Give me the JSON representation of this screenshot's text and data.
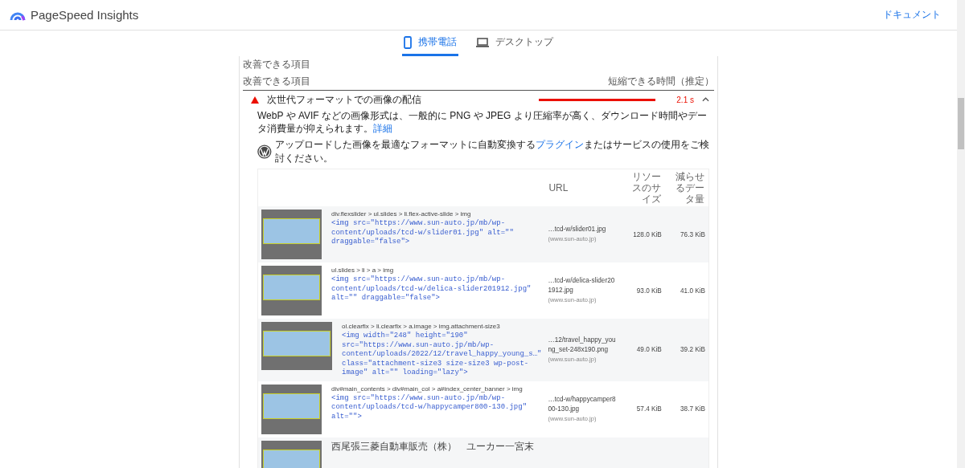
{
  "header": {
    "title": "PageSpeed Insights",
    "docs_link": "ドキュメント"
  },
  "tabs": [
    {
      "label": "携帯電話",
      "selected": true
    },
    {
      "label": "デスクトップ",
      "selected": false
    }
  ],
  "section_title": "改善できる項目",
  "list_header": {
    "left": "改善できる項目",
    "right": "短縮できる時間（推定）"
  },
  "audit": {
    "title": "次世代フォーマットでの画像の配信",
    "level": 1,
    "value": "2.1 s",
    "expanded": true,
    "description": "WebP や AVIF などの画像形式は、一般的に PNG や JPEG より圧縮率が高く、ダウンロード時間やデータ消費量が抑えられます。",
    "description_link": "詳細",
    "tip_before": "アップロードした画像を最適なフォーマットに自動変換する",
    "tip_link": "プラグイン",
    "tip_after": "またはサービスの使用をご検討ください。",
    "table": {
      "columns": [
        "URL",
        "リソースのサイズ",
        "減らせるデータ量"
      ],
      "rows": [
        {
          "kind": "banner",
          "selector": "div.flexslider > ul.slides > li.flex-active-slide > img",
          "snippet": "<img src=\"https://www.sun-auto.jp/mb/wp-content/uploads/tcd-w/slider01.jpg\" alt=\"\" draggable=\"false\">",
          "url": "…tcd-w/slider01.jpg",
          "host": "(www.sun-auto.jp)",
          "size": "128.0 KiB",
          "savings": "76.3 KiB"
        },
        {
          "kind": "banner",
          "selector": "ul.slides > li > a > img",
          "snippet": "<img src=\"https://www.sun-auto.jp/mb/wp-content/uploads/tcd-w/delica-slider201912.jpg\" alt=\"\" draggable=\"false\">",
          "url": "…tcd-w/delica-slider201912.jpg",
          "host": "(www.sun-auto.jp)",
          "size": "93.0 KiB",
          "savings": "41.0 KiB"
        },
        {
          "kind": "wide",
          "selector": "ol.clearfix > li.clearfix > a.image > img.attachment-size3",
          "snippet": "<img width=\"248\" height=\"190\" src=\"https://www.sun-auto.jp/mb/wp-content/uploads/2022/12/travel_happy_young_s…\" class=\"attachment-size3 size-size3 wp-post-image\" alt=\"\" loading=\"lazy\">",
          "url": "…12/travel_happy_young_set-248x190.png",
          "host": "(www.sun-auto.jp)",
          "size": "49.0 KiB",
          "savings": "39.2 KiB"
        },
        {
          "kind": "banner",
          "selector": "div#main_contents > div#main_col > a#index_center_banner > img",
          "snippet": "<img src=\"https://www.sun-auto.jp/mb/wp-content/uploads/tcd-w/happycamper800-130.jpg\" alt=\"\">",
          "url": "…tcd-w/happycamper800-130.jpg",
          "host": "(www.sun-auto.jp)",
          "size": "57.4 KiB",
          "savings": "38.7 KiB"
        },
        {
          "kind": "banner",
          "selector": "西尾張三菱自動車販売（株）　ユーカー一宮末"
        }
      ]
    }
  }
}
